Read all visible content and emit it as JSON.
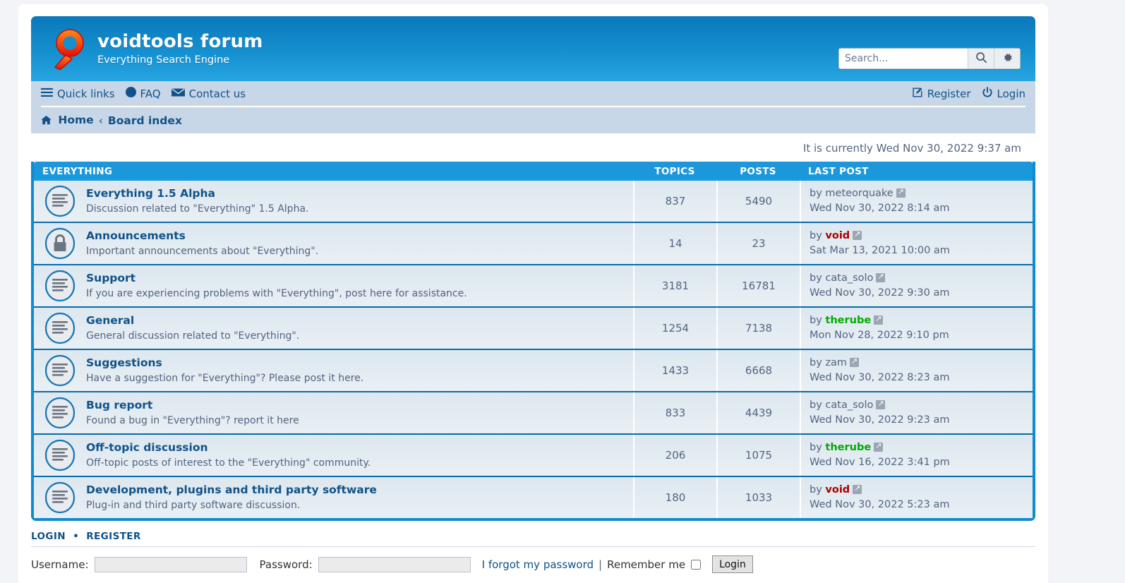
{
  "header": {
    "logo_icon": "magnifier-logo-icon",
    "title": "voidtools forum",
    "description": "Everything Search Engine",
    "brand_color": "#1590cf",
    "logo_color": "#f04a12"
  },
  "search": {
    "placeholder": "Search...",
    "value": "",
    "search_icon": "search-icon",
    "options_icon": "gear-icon"
  },
  "nav": {
    "quick_links": "Quick links",
    "faq": "FAQ",
    "contact": "Contact us",
    "register": "Register",
    "login": "Login"
  },
  "breadcrumb": {
    "home": "Home",
    "separator": "‹",
    "board_index": "Board index"
  },
  "status": {
    "current_time": "It is currently Wed Nov 30, 2022 9:37 am"
  },
  "forum_table": {
    "category": "EVERYTHING",
    "columns": {
      "topics": "TOPICS",
      "posts": "POSTS",
      "last_post": "LAST POST"
    },
    "rows": [
      {
        "icon": "forum-unread-icon",
        "name": "Everything 1.5 Alpha",
        "description": "Discussion related to \"Everything\" 1.5 Alpha.",
        "topics": "837",
        "posts": "5490",
        "by_label": "by",
        "author": "meteorquake",
        "author_style": "normal",
        "date": "Wed Nov 30, 2022 8:14 am"
      },
      {
        "icon": "forum-locked-icon",
        "name": "Announcements",
        "description": "Important announcements about \"Everything\".",
        "topics": "14",
        "posts": "23",
        "by_label": "by",
        "author": "void",
        "author_style": "admin",
        "date": "Sat Mar 13, 2021 10:00 am"
      },
      {
        "icon": "forum-unread-icon",
        "name": "Support",
        "description": "If you are experiencing problems with \"Everything\", post here for assistance.",
        "topics": "3181",
        "posts": "16781",
        "by_label": "by",
        "author": "cata_solo",
        "author_style": "normal",
        "date": "Wed Nov 30, 2022 9:30 am"
      },
      {
        "icon": "forum-unread-icon",
        "name": "General",
        "description": "General discussion related to \"Everything\".",
        "topics": "1254",
        "posts": "7138",
        "by_label": "by",
        "author": "therube",
        "author_style": "mod",
        "date": "Mon Nov 28, 2022 9:10 pm"
      },
      {
        "icon": "forum-unread-icon",
        "name": "Suggestions",
        "description": "Have a suggestion for \"Everything\"? Please post it here.",
        "topics": "1433",
        "posts": "6668",
        "by_label": "by",
        "author": "zam",
        "author_style": "normal",
        "date": "Wed Nov 30, 2022 8:23 am"
      },
      {
        "icon": "forum-unread-icon",
        "name": "Bug report",
        "description": "Found a bug in \"Everything\"? report it here",
        "topics": "833",
        "posts": "4439",
        "by_label": "by",
        "author": "cata_solo",
        "author_style": "normal",
        "date": "Wed Nov 30, 2022 9:23 am"
      },
      {
        "icon": "forum-unread-icon",
        "name": "Off-topic discussion",
        "description": "Off-topic posts of interest to the \"Everything\" community.",
        "topics": "206",
        "posts": "1075",
        "by_label": "by",
        "author": "therube",
        "author_style": "mod",
        "date": "Wed Nov 16, 2022 3:41 pm"
      },
      {
        "icon": "forum-unread-icon",
        "name": "Development, plugins and third party software",
        "description": "Plug-in and third party software discussion.",
        "topics": "180",
        "posts": "1033",
        "by_label": "by",
        "author": "void",
        "author_style": "admin",
        "date": "Wed Nov 30, 2022 5:23 am"
      }
    ]
  },
  "login_panel": {
    "heading_login": "LOGIN",
    "heading_sep": "•",
    "heading_register": "REGISTER",
    "username_label": "Username:",
    "username_value": "",
    "password_label": "Password:",
    "password_value": "",
    "forgot_password": "I forgot my password",
    "pipe": "|",
    "remember_me": "Remember me",
    "login_button": "Login"
  },
  "colors": {
    "admin": "#AA0000",
    "moderator": "#00AA00",
    "link": "#105289",
    "text": "#536482"
  }
}
